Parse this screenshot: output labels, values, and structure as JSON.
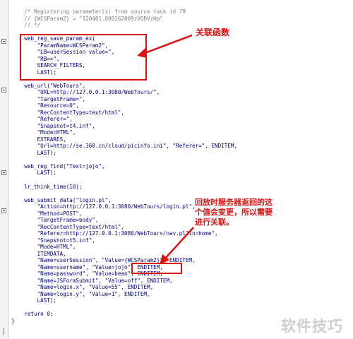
{
  "editor": {
    "lines": [
      {
        "text": "    /* Registering parameter(s) from source task id 79",
        "kind": "comment"
      },
      {
        "text": "    // {WCSParam2} = \"120401.800162009zVQDVzHp\"",
        "kind": "comment"
      },
      {
        "text": "    // */",
        "kind": "comment"
      },
      {
        "text": "",
        "kind": "code"
      },
      {
        "text": "    web_reg_save_param_ex(",
        "kind": "code"
      },
      {
        "text": "        \"ParamName=WCSParam2\",",
        "kind": "code"
      },
      {
        "text": "        \"LB=userSession value=\",",
        "kind": "code"
      },
      {
        "text": "        \"RB=>\",",
        "kind": "code"
      },
      {
        "text": "        SEARCH_FILTERS,",
        "kind": "code"
      },
      {
        "text": "        LAST);",
        "kind": "code"
      },
      {
        "text": "",
        "kind": "code"
      },
      {
        "text": "    web_url(\"WebTours\",",
        "kind": "code"
      },
      {
        "text": "        \"URL=http://127.0.0.1:3080/WebTours/\",",
        "kind": "code"
      },
      {
        "text": "        \"TargetFrame=\",",
        "kind": "code"
      },
      {
        "text": "        \"Resource=0\",",
        "kind": "code"
      },
      {
        "text": "        \"RecContentType=text/html\",",
        "kind": "code"
      },
      {
        "text": "        \"Referer=\",",
        "kind": "code"
      },
      {
        "text": "        \"Snapshot=t4.inf\",",
        "kind": "code"
      },
      {
        "text": "        \"Mode=HTML\",",
        "kind": "code"
      },
      {
        "text": "        EXTRARES,",
        "kind": "code"
      },
      {
        "text": "        \"Url=http://se.360.cn/cloud/picinfo.ini\", \"Referer=\", ENDITEM,",
        "kind": "code"
      },
      {
        "text": "        LAST);",
        "kind": "code"
      },
      {
        "text": "",
        "kind": "code"
      },
      {
        "text": "    web_reg_find(\"Text=jojo\",",
        "kind": "code"
      },
      {
        "text": "        LAST);",
        "kind": "code"
      },
      {
        "text": "",
        "kind": "code"
      },
      {
        "text": "    lr_think_time(10);",
        "kind": "code"
      },
      {
        "text": "",
        "kind": "code"
      },
      {
        "text": "    web_submit_data(\"login.pl\",",
        "kind": "code"
      },
      {
        "text": "        \"Action=http://127.0.0.1:3080/WebTours/login.pl\",",
        "kind": "code"
      },
      {
        "text": "        \"Method=POST\",",
        "kind": "code"
      },
      {
        "text": "        \"TargetFrame=body\",",
        "kind": "code"
      },
      {
        "text": "        \"RecContentType=text/html\",",
        "kind": "code"
      },
      {
        "text": "        \"Referer=http://127.0.0.1:3080/WebTours/nav.pl?in=home\",",
        "kind": "code"
      },
      {
        "text": "        \"Snapshot=t5.inf\",",
        "kind": "code"
      },
      {
        "text": "        \"Mode=HTML\",",
        "kind": "code"
      },
      {
        "text": "        ITEMDATA,",
        "kind": "code"
      },
      {
        "text": "        \"Name=userSession\", \"Value={WCSParam2}\", ENDITEM,",
        "kind": "code"
      },
      {
        "text": "        \"Name=username\", \"Value=jojo\", ENDITEM,",
        "kind": "code"
      },
      {
        "text": "        \"Name=password\", \"Value=bean\", ENDITEM,",
        "kind": "code"
      },
      {
        "text": "        \"Name=JSFormSubmit\", \"Value=off\", ENDITEM,",
        "kind": "code"
      },
      {
        "text": "        \"Name=login.x\", \"Value=55\", ENDITEM,",
        "kind": "code"
      },
      {
        "text": "        \"Name=login.y\", \"Value=1\", ENDITEM,",
        "kind": "code"
      },
      {
        "text": "        LAST);",
        "kind": "code"
      },
      {
        "text": "",
        "kind": "code"
      },
      {
        "text": "    return 0;",
        "kind": "code"
      },
      {
        "text": "}",
        "kind": "code"
      }
    ]
  },
  "annotations": {
    "func_label": "关联函数",
    "note_line1": "回放时服务器返回的这",
    "note_line2": "个值会变更，所以需要",
    "note_line3": "进行关联。",
    "color": "#e01010"
  },
  "watermark": "软件技巧"
}
